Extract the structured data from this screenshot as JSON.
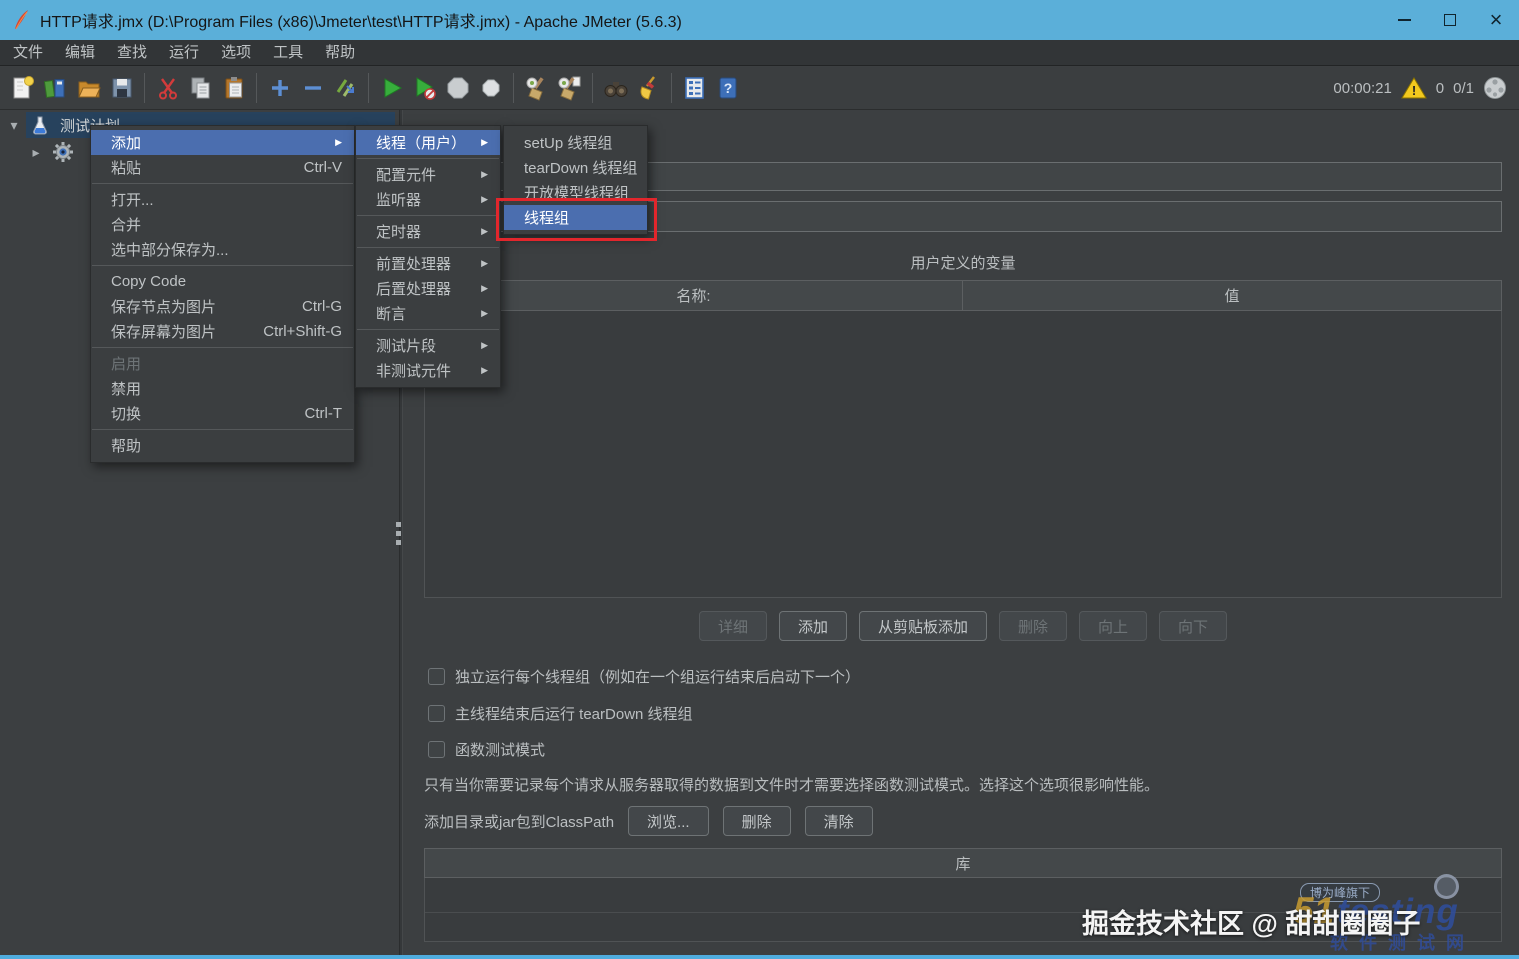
{
  "window": {
    "title": "HTTP请求.jmx (D:\\Program Files (x86)\\Jmeter\\test\\HTTP请求.jmx) - Apache JMeter (5.6.3)"
  },
  "menubar": {
    "items": [
      "文件",
      "编辑",
      "查找",
      "运行",
      "选项",
      "工具",
      "帮助"
    ]
  },
  "toolbar": {
    "icons": [
      "new-file",
      "templates",
      "open-file",
      "save",
      "cut",
      "copy",
      "paste",
      "add",
      "remove",
      "toggle",
      "start",
      "start-no-timers",
      "stop",
      "shutdown",
      "clear",
      "clear-all",
      "search",
      "clear-search",
      "function-helper",
      "help"
    ],
    "status": {
      "elapsed": "00:00:21",
      "log_errors": "0",
      "threads": "0/1"
    }
  },
  "tree": {
    "root_label": "测试计划"
  },
  "context_menu": {
    "items": [
      {
        "label": "添加",
        "state": "selected",
        "has_submenu": true
      },
      {
        "label": "粘贴",
        "accel": "Ctrl-V"
      },
      {
        "label": "打开..."
      },
      {
        "label": "合并"
      },
      {
        "label": "选中部分保存为..."
      },
      {
        "label": "Copy Code"
      },
      {
        "label": "保存节点为图片",
        "accel": "Ctrl-G"
      },
      {
        "label": "保存屏幕为图片",
        "accel": "Ctrl+Shift-G"
      },
      {
        "label": "启用",
        "state": "disabled"
      },
      {
        "label": "禁用"
      },
      {
        "label": "切换",
        "accel": "Ctrl-T"
      },
      {
        "label": "帮助"
      }
    ]
  },
  "add_submenu": {
    "items": [
      {
        "label": "线程（用户）",
        "state": "selected"
      },
      {
        "label": "配置元件"
      },
      {
        "label": "监听器"
      },
      {
        "label": "定时器"
      },
      {
        "label": "前置处理器"
      },
      {
        "label": "后置处理器"
      },
      {
        "label": "断言"
      },
      {
        "label": "测试片段"
      },
      {
        "label": "非测试元件"
      }
    ]
  },
  "threads_submenu": {
    "items": [
      {
        "label": "setUp 线程组"
      },
      {
        "label": "tearDown 线程组"
      },
      {
        "label": "开放模型线程组"
      },
      {
        "label": "线程组",
        "state": "selected",
        "annotated": true
      }
    ]
  },
  "main": {
    "name_field_value": "",
    "comments_field_value": "",
    "udv_title": "用户定义的变量",
    "table": {
      "col_name": "名称:",
      "col_value": "值"
    },
    "buttons": {
      "detail": "详细",
      "add": "添加",
      "add_from_clipboard": "从剪贴板添加",
      "delete": "删除",
      "up": "向上",
      "down": "向下"
    },
    "checkboxes": [
      {
        "label": "独立运行每个线程组（例如在一个组运行结束后启动下一个）",
        "checked": false
      },
      {
        "label": "主线程结束后运行 tearDown 线程组",
        "checked": false
      },
      {
        "label": "函数测试模式",
        "checked": false
      }
    ],
    "note": "只有当你需要记录每个请求从服务器取得的数据到文件时才需要选择函数测试模式。选择这个选项很影响性能。",
    "classpath": {
      "label": "添加目录或jar包到ClassPath",
      "browse": "浏览...",
      "delete": "删除",
      "clear": "清除"
    },
    "library_header": "库"
  },
  "watermark": {
    "badge": "博为峰旗下",
    "logo_51": "51",
    "logo_testing": "testing",
    "logo_sub": "软件测试网",
    "overlay": "掘金技术社区 @ 甜甜圈圈子"
  }
}
